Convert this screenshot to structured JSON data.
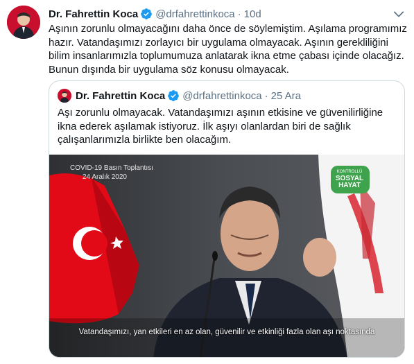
{
  "tweet": {
    "author_name": "Dr. Fahrettin Koca",
    "handle": "@drfahrettinkoca",
    "separator": "·",
    "time": "10d",
    "text_lines": [
      "Aşının zorunlu olmayacağını daha önce de söylemiştim. Aşılama programımız",
      "hazır. Vatandaşımızı zorlayıcı bir uygulama olmayacak. Aşının gerekliliğini",
      "bilim insanlarımızla toplumumuza anlatarak ikna etme çabası içinde olacağız.",
      "Bunun dışında bir uygulama söz konusu olmayacak."
    ]
  },
  "quote": {
    "author_name": "Dr. Fahrettin Koca",
    "handle": "@drfahrettinkoca",
    "separator": "·",
    "time": "25 Ara",
    "text_lines": [
      "Aşı zorunlu olmayacak. Vatandaşımızı aşının etkisine ve güvenilirliğine",
      "ikna ederek aşılamak istiyoruz. İlk aşıyı olanlardan biri de sağlık",
      "çalışanlarımızla birlikte ben olacağım."
    ],
    "media": {
      "overlay_title": "COVID-19 Basın Toplantısı",
      "overlay_date": "24 Aralık 2020",
      "badge_top": "KONTROLLÜ",
      "badge_line1": "SOSYAL",
      "badge_line2": "HAYAT",
      "subtitle": "Vatandaşımızı, yan etkileri en az olan, güvenilir ve etkinliği fazla olan aşı noktasında"
    }
  },
  "colors": {
    "verified": "#1d9bf0",
    "secondary_text": "#5b7083",
    "border": "#cfd9de",
    "flag_red": "#e30a17"
  }
}
